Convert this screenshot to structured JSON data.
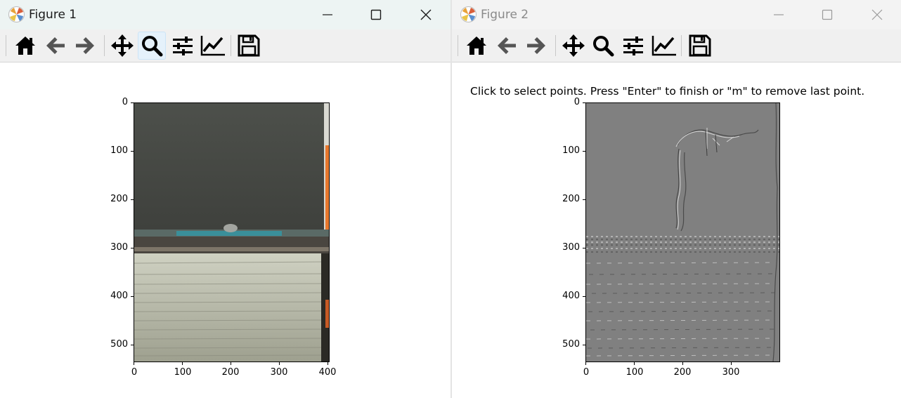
{
  "windows": [
    {
      "title": "Figure 1",
      "toolbar": [
        "home-icon",
        "back-arrow-icon",
        "forward-arrow-icon",
        "pan-icon",
        "zoom-icon",
        "configure-subplots-icon",
        "edit-axes-icon",
        "save-icon"
      ],
      "active_tool": "zoom-icon",
      "prompt": "",
      "image": "photo of a stack of book pages below a dark grey background with a teal strip",
      "yticks": [
        "0",
        "100",
        "200",
        "300",
        "400",
        "500"
      ],
      "xticks": [
        "0",
        "100",
        "200",
        "300",
        "400"
      ]
    },
    {
      "title": "Figure 2",
      "toolbar": [
        "home-icon",
        "back-arrow-icon",
        "forward-arrow-icon",
        "pan-icon",
        "zoom-icon",
        "configure-subplots-icon",
        "edit-axes-icon",
        "save-icon"
      ],
      "active_tool": "",
      "prompt": "Click to select points. Press \"Enter\" to finish or \"m\" to remove last point.",
      "image": "grey edge-detection image of the same scene",
      "yticks": [
        "0",
        "100",
        "200",
        "300",
        "400",
        "500"
      ],
      "xticks": [
        "0",
        "100",
        "200",
        "300"
      ]
    }
  ],
  "window_controls": [
    "minimize-icon",
    "maximize-icon",
    "close-icon"
  ]
}
